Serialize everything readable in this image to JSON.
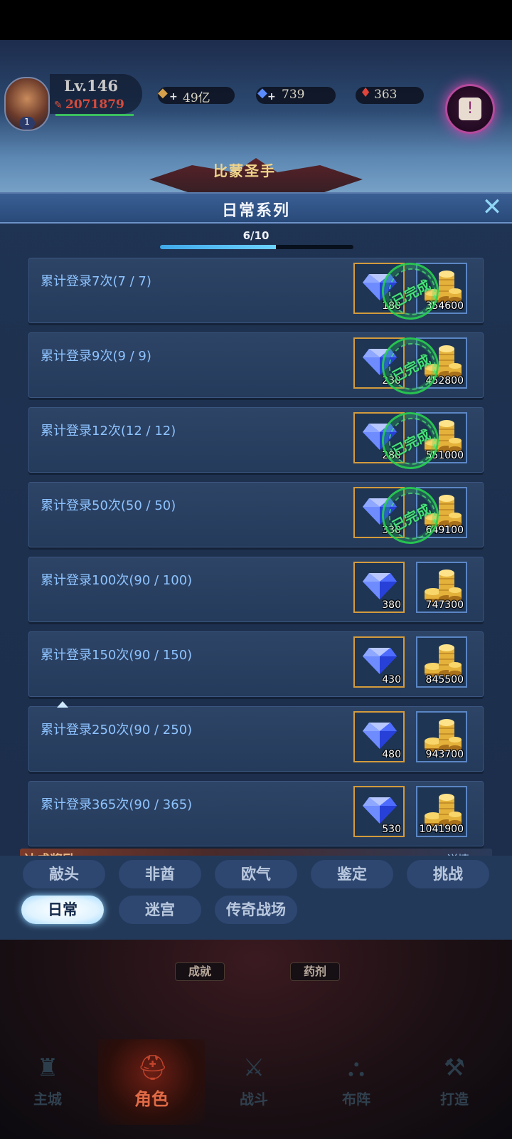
{
  "player": {
    "level": "Lv.146",
    "power": "2071879",
    "rank_badge": "1"
  },
  "resources": [
    {
      "icon": "gold-icon",
      "value": "49亿",
      "color": "#d6a14a"
    },
    {
      "icon": "diamond-icon",
      "value": "739",
      "color": "#5b8cff"
    },
    {
      "icon": "blood-gem-icon",
      "value": "363",
      "color": "#e0443a"
    }
  ],
  "background": {
    "banner_text": "比蒙圣手"
  },
  "modal": {
    "title": "日常系列",
    "close_icon": "close-icon",
    "progress": {
      "text": "6/10",
      "fraction": 0.6
    }
  },
  "tasks": [
    {
      "label": "累计登录7次(7 / 7)",
      "diamond": "180",
      "gold": "354600",
      "completed": true
    },
    {
      "label": "累计登录9次(9 / 9)",
      "diamond": "230",
      "gold": "452800",
      "completed": true
    },
    {
      "label": "累计登录12次(12 / 12)",
      "diamond": "280",
      "gold": "551000",
      "completed": true
    },
    {
      "label": "累计登录50次(50 / 50)",
      "diamond": "330",
      "gold": "649100",
      "completed": true
    },
    {
      "label": "累计登录100次(90 / 100)",
      "diamond": "380",
      "gold": "747300",
      "completed": false
    },
    {
      "label": "累计登录150次(90 / 150)",
      "diamond": "430",
      "gold": "845500",
      "completed": false
    },
    {
      "label": "累计登录250次(90 / 250)",
      "diamond": "480",
      "gold": "943700",
      "completed": false
    },
    {
      "label": "累计登录365次(90 / 365)",
      "diamond": "530",
      "gold": "1041900",
      "completed": false
    }
  ],
  "stamp_text": "已完成",
  "bonus_strip": {
    "label": "达成奖励",
    "more": "详情"
  },
  "category_tabs": {
    "row1": [
      "敲头",
      "非酋",
      "欧气",
      "鉴定",
      "挑战"
    ],
    "row2": [
      "日常",
      "迷宫",
      "传奇战场"
    ],
    "active": "日常"
  },
  "under_modal_buttons": [
    "成就",
    "药剂"
  ],
  "bottom_nav": [
    {
      "label": "主城",
      "icon": "castle-icon"
    },
    {
      "label": "角色",
      "icon": "helmet-icon",
      "active": true
    },
    {
      "label": "战斗",
      "icon": "crossed-swords-icon"
    },
    {
      "label": "布阵",
      "icon": "formation-icon"
    },
    {
      "label": "打造",
      "icon": "anvil-icon"
    }
  ]
}
